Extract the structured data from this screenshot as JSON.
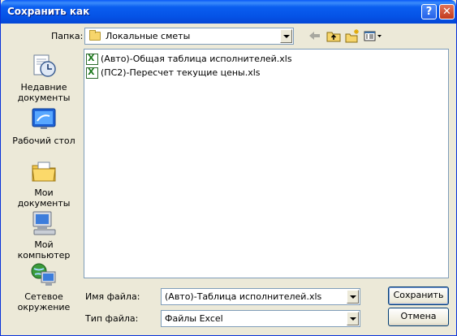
{
  "window": {
    "title": "Сохранить как",
    "help_icon": "?",
    "close_icon": "✕"
  },
  "folder_bar": {
    "label": "Папка:",
    "current_folder": "Локальные сметы",
    "toolbar_icons": [
      "back-arrow-icon",
      "up-one-level-icon",
      "new-folder-icon",
      "views-menu-icon"
    ]
  },
  "places": [
    {
      "label_lines": [
        "Недавние",
        "документы"
      ],
      "icon": "recent-documents-icon"
    },
    {
      "label_lines": [
        "Рабочий стол"
      ],
      "icon": "desktop-icon"
    },
    {
      "label_lines": [
        "Мои документы"
      ],
      "icon": "my-documents-icon"
    },
    {
      "label_lines": [
        "Мой компьютер"
      ],
      "icon": "my-computer-icon"
    },
    {
      "label_lines": [
        "Сетевое",
        "окружение"
      ],
      "icon": "network-places-icon"
    }
  ],
  "files": [
    {
      "name": "(Авто)-Общая таблица исполнителей.xls",
      "icon": "excel-file-icon"
    },
    {
      "name": "(ПС2)-Пересчет текущие цены.xls",
      "icon": "excel-file-icon"
    }
  ],
  "filename": {
    "label": "Имя файла:",
    "value": "(Авто)-Таблица исполнителей.xls"
  },
  "filetype": {
    "label": "Тип файла:",
    "value": "Файлы Excel"
  },
  "buttons": {
    "save": "Сохранить",
    "cancel": "Отмена"
  },
  "colors": {
    "titlebar": "#0553e6",
    "dialog_bg": "#ece9d8",
    "field_border": "#7f9db9",
    "close_button": "#c2391b"
  }
}
